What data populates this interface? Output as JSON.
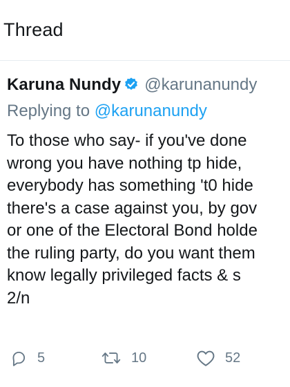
{
  "header": {
    "title": "Thread"
  },
  "tweet": {
    "author_name": "Karuna Nundy",
    "handle": "@karunanundy",
    "replying_prefix": "Replying to ",
    "replying_handle": "@karunanundy",
    "body_lines": [
      "To those who say- if you've done",
      "wrong you have nothing tp hide,",
      "everybody has something 't0 hide",
      "there's a case against you, by gov",
      "or one of the Electoral Bond holde",
      "the ruling party, do you want them",
      "know  legally privileged facts & s",
      "2/n"
    ],
    "actions": {
      "reply_count": "5",
      "retweet_count": "10",
      "like_count": "52"
    }
  },
  "colors": {
    "text": "#14171a",
    "secondary": "#657786",
    "accent": "#1da1f2",
    "verified": "#1da1f2"
  },
  "icons": [
    "verified-badge-icon",
    "reply-icon",
    "retweet-icon",
    "like-icon"
  ]
}
